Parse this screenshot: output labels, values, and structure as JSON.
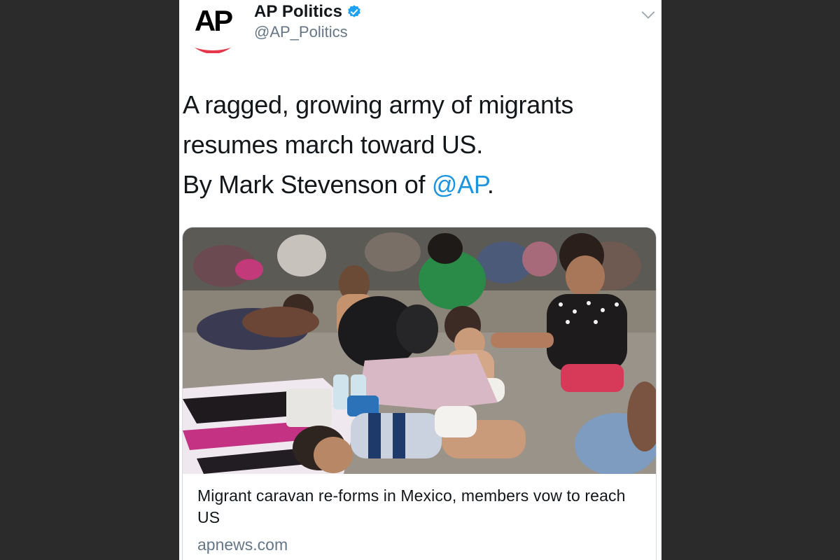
{
  "tweet": {
    "display_name": "AP Politics",
    "handle": "@AP_Politics",
    "avatar_text": "AP",
    "verified": true,
    "text_lines": [
      "A ragged, growing army of migrants",
      "resumes march toward US."
    ],
    "byline_prefix": "By Mark Stevenson of ",
    "mention": "@AP",
    "byline_suffix": "."
  },
  "card": {
    "title": "Migrant caravan re-forms in Mexico, members vow to reach US",
    "domain": "apnews.com"
  },
  "colors": {
    "background": "#2b2b2b",
    "link": "#1b95e0",
    "verified": "#1da1f2",
    "ap_red": "#e5364a",
    "text": "#14171a",
    "muted": "#657786"
  }
}
